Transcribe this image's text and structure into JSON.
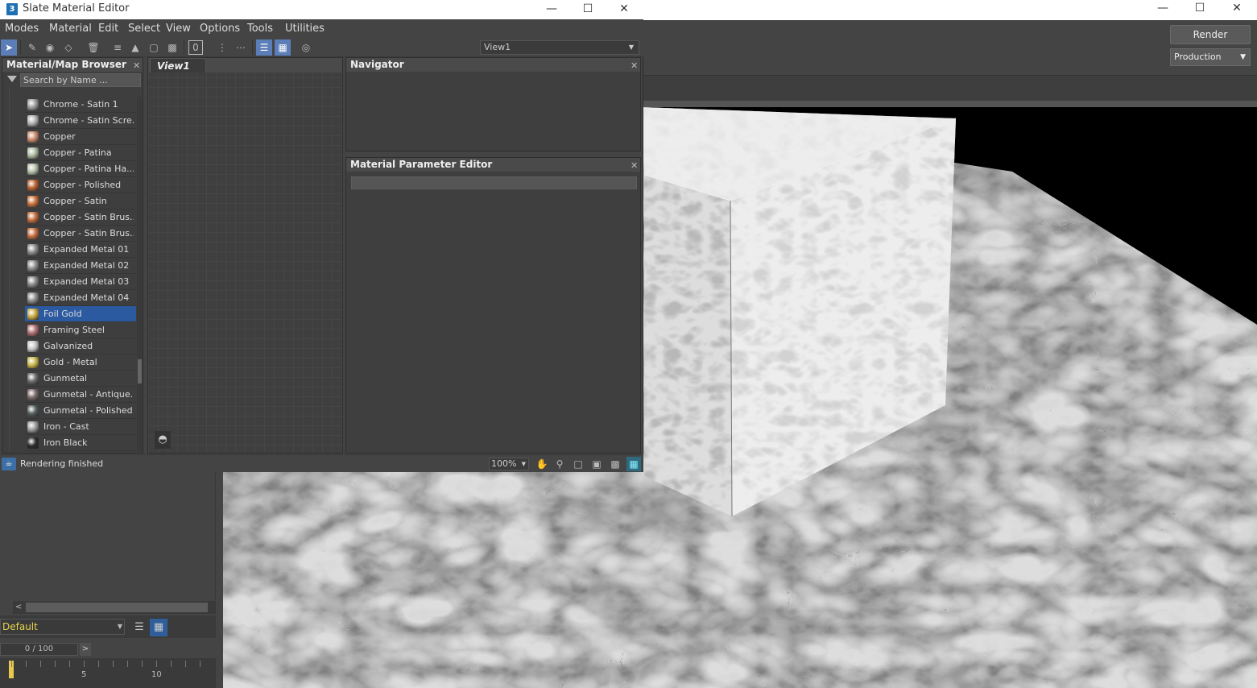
{
  "background_app": {
    "render_label": "Render",
    "render_mode": "Production",
    "layer_name": "Default",
    "frame_counter": "0 / 100",
    "timeline_labels": [
      "0",
      "5",
      "10"
    ]
  },
  "window": {
    "title": "Slate Material Editor",
    "app_icon": "3",
    "menu": [
      "Modes",
      "Material",
      "Edit",
      "Select",
      "View",
      "Options",
      "Tools",
      "Utilities"
    ],
    "view_select": "View1"
  },
  "browser": {
    "title": "Material/Map Browser",
    "search_placeholder": "Search by Name ...",
    "items": [
      {
        "label": "Chrome - Satin 1",
        "color": "#9a9a9a"
      },
      {
        "label": "Chrome - Satin Scre...",
        "color": "#b0b0b0"
      },
      {
        "label": "Copper",
        "color": "#c98a6a"
      },
      {
        "label": "Copper - Patina",
        "color": "#a9b89e"
      },
      {
        "label": "Copper - Patina Ha...",
        "color": "#b3bfa8"
      },
      {
        "label": "Copper - Polished",
        "color": "#b8612f"
      },
      {
        "label": "Copper - Satin",
        "color": "#c9703a"
      },
      {
        "label": "Copper - Satin Brus...",
        "color": "#c26a3c"
      },
      {
        "label": "Copper - Satin Brus...",
        "color": "#c46c3e"
      },
      {
        "label": "Expanded Metal 01",
        "color": "#8a8a8a"
      },
      {
        "label": "Expanded Metal 02",
        "color": "#8c8c8c"
      },
      {
        "label": "Expanded Metal 03",
        "color": "#888888"
      },
      {
        "label": "Expanded Metal 04",
        "color": "#8b8b8b"
      },
      {
        "label": "Foil Gold",
        "color": "#c9a73c",
        "selected": true
      },
      {
        "label": "Framing Steel",
        "color": "#b07070"
      },
      {
        "label": "Galvanized",
        "color": "#c4c4c4"
      },
      {
        "label": "Gold - Metal",
        "color": "#c8b54a"
      },
      {
        "label": "Gunmetal",
        "color": "#6a6a6a"
      },
      {
        "label": "Gunmetal - Antique...",
        "color": "#7a6a6a"
      },
      {
        "label": "Gunmetal - Polished",
        "color": "#555e5e"
      },
      {
        "label": "Iron - Cast",
        "color": "#9c9c9c"
      },
      {
        "label": "Iron Black",
        "color": "#2a2a2a"
      }
    ]
  },
  "view1": {
    "tab_label": "View1"
  },
  "navigator": {
    "title": "Navigator"
  },
  "param_editor": {
    "title": "Material Parameter Editor"
  },
  "status": {
    "text": "Rendering finished",
    "zoom": "100%"
  }
}
